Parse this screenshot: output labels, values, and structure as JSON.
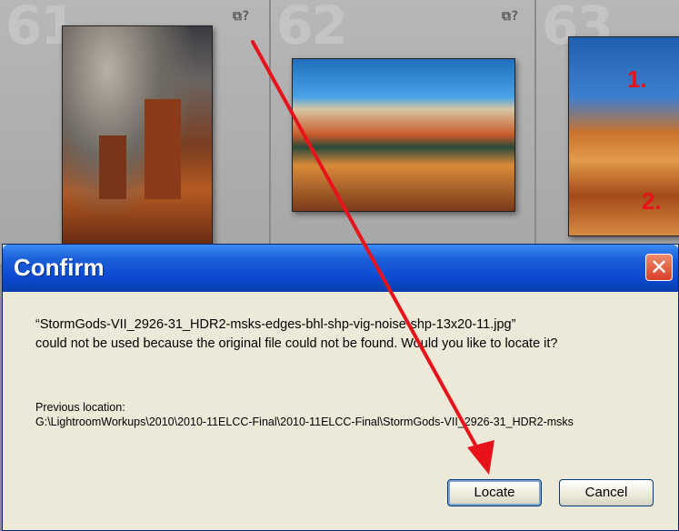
{
  "grid": {
    "cells": [
      {
        "number": "61",
        "badge": "⧉?"
      },
      {
        "number": "62",
        "badge": "⧉?"
      },
      {
        "number": "63",
        "badge": ""
      }
    ]
  },
  "dialog": {
    "title": "Confirm",
    "close_label": "✕",
    "message_line1": "“StormGods-VII_2926-31_HDR2-msks-edges-bhl-shp-vig-noise-shp-13x20-11.jpg”",
    "message_line2": "could not be used because the original file could not be found. Would you like to locate it?",
    "previous_location_label": "Previous location:",
    "previous_location_path": "G:\\LightroomWorkups\\2010\\2010-11ELCC-Final\\2010-11ELCC-Final\\StormGods-VII_2926-31_HDR2-msks",
    "locate_label": "Locate",
    "cancel_label": "Cancel"
  },
  "annotations": {
    "step1": "1.",
    "step2": "2.",
    "arrow_color": "#e8131a"
  },
  "colors": {
    "titlebar": "#0a4ad0",
    "close_button": "#d8402a",
    "dialog_bg": "#ece9d8"
  }
}
